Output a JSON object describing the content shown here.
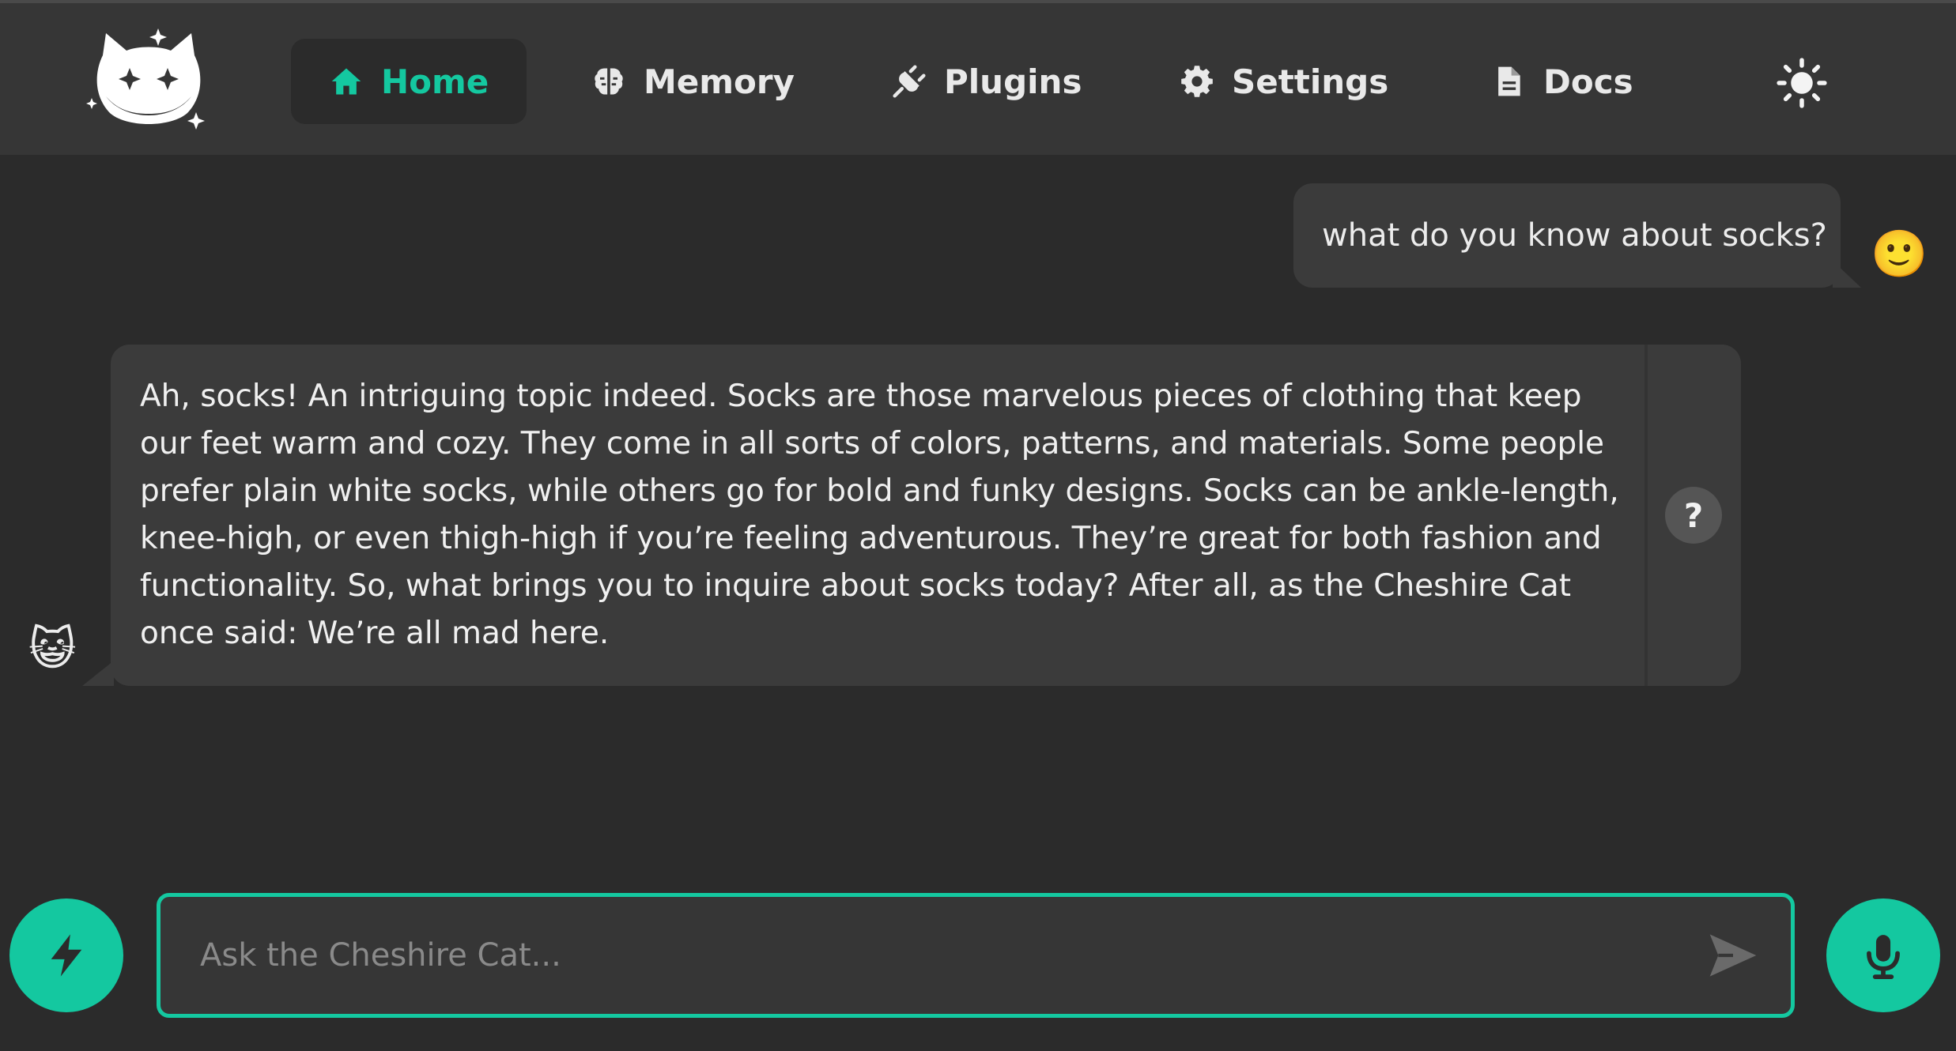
{
  "brand": {
    "logo_icon": "cheshire-cat-logo-icon"
  },
  "nav": {
    "items": [
      {
        "label": "Home",
        "icon": "home-icon",
        "active": true
      },
      {
        "label": "Memory",
        "icon": "brain-icon",
        "active": false
      },
      {
        "label": "Plugins",
        "icon": "plug-icon",
        "active": false
      },
      {
        "label": "Settings",
        "icon": "gear-icon",
        "active": false
      },
      {
        "label": "Docs",
        "icon": "document-icon",
        "active": false
      }
    ],
    "theme_toggle_icon": "sun-icon"
  },
  "chat": {
    "messages": [
      {
        "sender": "user",
        "text": "what do you know about socks?",
        "avatar": "🙂"
      },
      {
        "sender": "bot",
        "text": "Ah, socks! An intriguing topic indeed. Socks are those marvelous pieces of clothing that keep our feet warm and cozy. They come in all sorts of colors, patterns, and materials. Some people prefer plain white socks, while others go for bold and funky designs. Socks can be ankle-length, knee-high, or even thigh-high if you’re feeling adventurous. They’re great for both fashion and functionality. So, what brings you to inquire about socks today? After all, as the Cheshire Cat once said: We’re all mad here.",
        "avatar": "😺",
        "why_label": "?"
      }
    ]
  },
  "input": {
    "placeholder": "Ask the Cheshire Cat...",
    "value": ""
  },
  "actions": {
    "quick_icon": "lightning-icon",
    "send_icon": "send-icon",
    "mic_icon": "microphone-icon"
  },
  "colors": {
    "accent": "#14c8a0",
    "background": "#2b2b2b",
    "topbar": "#363636",
    "bubble": "#3b3b3b"
  }
}
